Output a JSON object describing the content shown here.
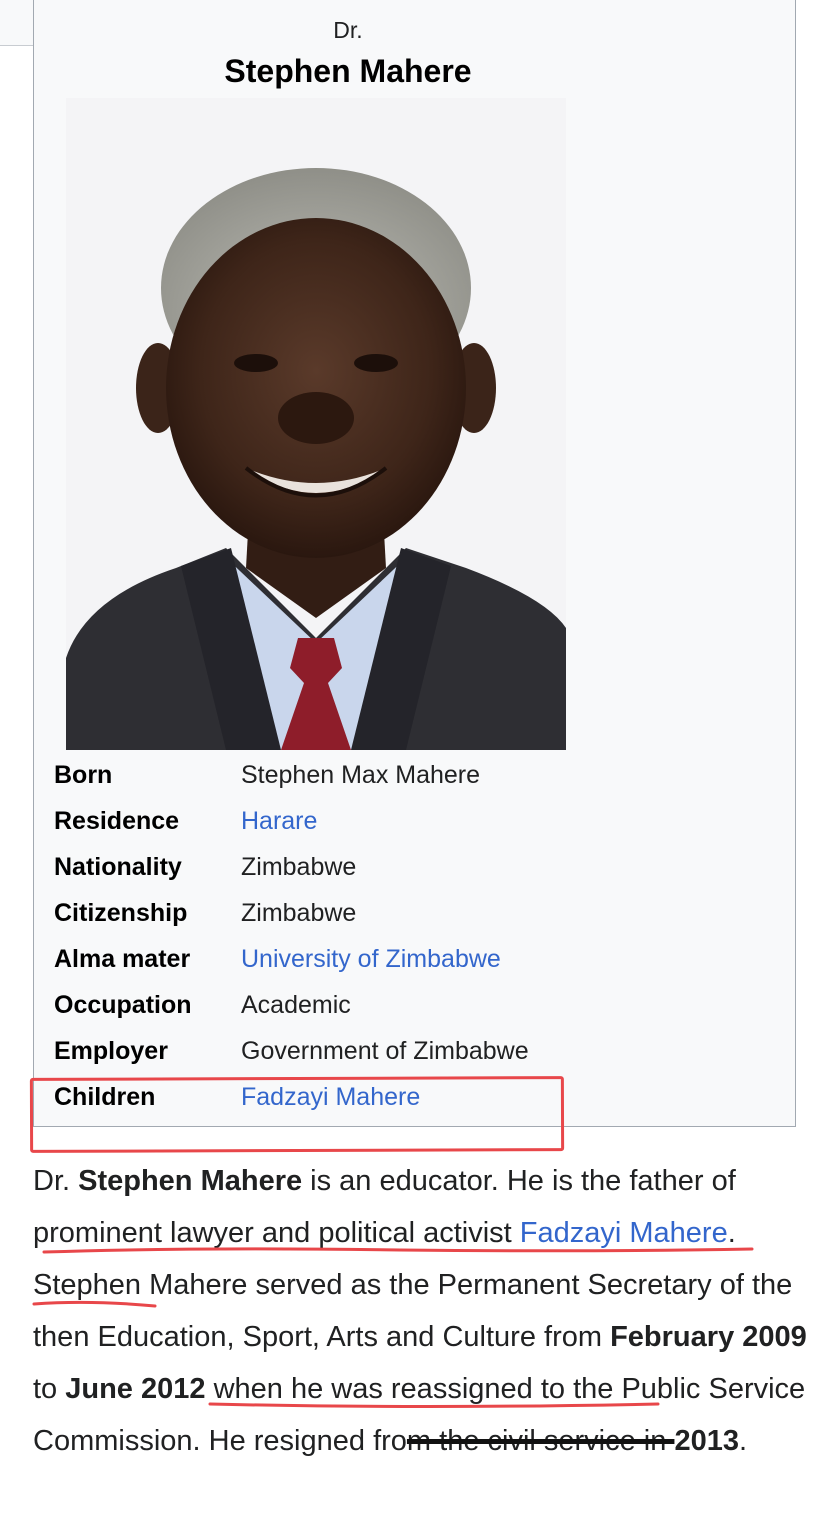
{
  "collapse_icon": "chevron-up-icon",
  "infobox": {
    "honorific": "Dr.",
    "name": "Stephen Mahere",
    "photo_icon": "portrait-photo",
    "rows": [
      {
        "label": "Born",
        "value": "Stephen Max Mahere",
        "link": false
      },
      {
        "label": "Residence",
        "value": "Harare",
        "link": true
      },
      {
        "label": "Nationality",
        "value": "Zimbabwe",
        "link": false
      },
      {
        "label": "Citizenship",
        "value": "Zimbabwe",
        "link": false
      },
      {
        "label": "Alma mater",
        "value": "University of Zimbabwe",
        "link": true
      },
      {
        "label": "Occupation",
        "value": "Academic",
        "link": false
      },
      {
        "label": "Employer",
        "value": "Government of Zimbabwe",
        "link": false
      },
      {
        "label": "Children",
        "value": "Fadzayi Mahere",
        "link": true
      }
    ]
  },
  "article": {
    "t1": "Dr. ",
    "t2": "Stephen Mahere",
    "t3": " is an educator. He is the father of prominent lawyer and political activist ",
    "t4": "Fadzayi Mahere",
    "t5": ". Stephen Mahere served as the Permanent Secretary of the then Education, Sport, Arts and Culture from ",
    "t6": "February 2009",
    "t7": " to ",
    "t8": "June 2012",
    "t9": " when he was reassigned to the Public Service Commission. He resigned fro",
    "t10": "m the civil service in ",
    "t11": "2013",
    "t12": "."
  },
  "colors": {
    "link": "#3366cc",
    "annotation": "#e8474a",
    "infobox_bg": "#f8f9fa",
    "infobox_border": "#a2a9b1"
  }
}
